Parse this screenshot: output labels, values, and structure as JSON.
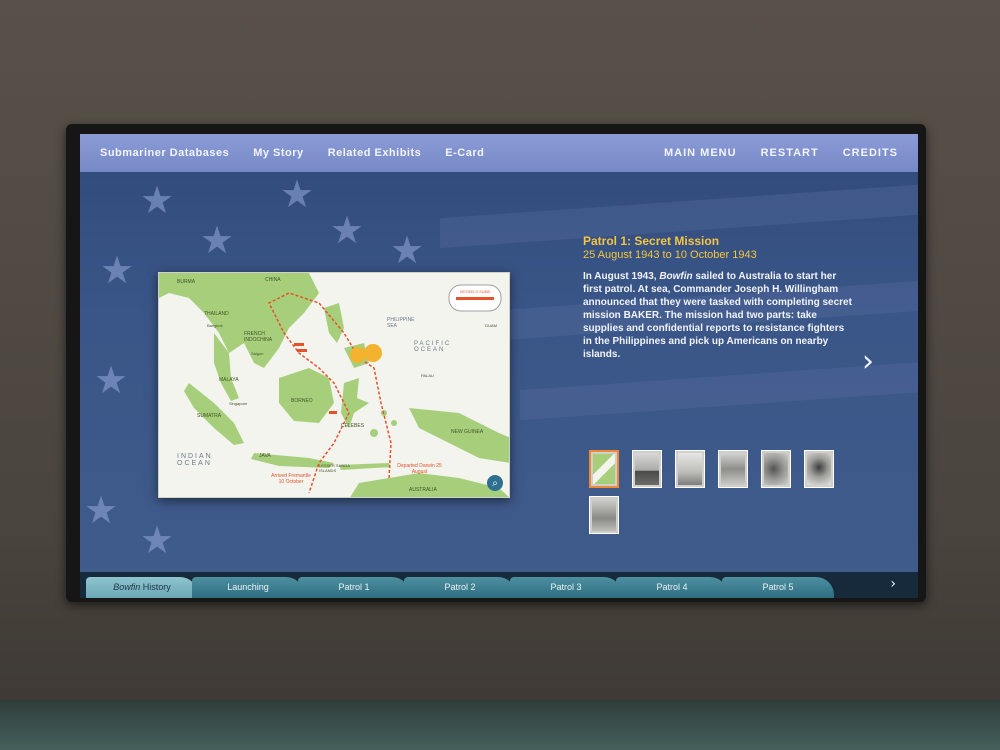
{
  "topnav": {
    "left": [
      "Submariner Databases",
      "My Story",
      "Related Exhibits",
      "E-Card"
    ],
    "right": [
      "MAIN MENU",
      "RESTART",
      "CREDITS"
    ]
  },
  "patrol": {
    "title": "Patrol 1: Secret Mission",
    "dates": "25 August 1943 to 10 October 1943",
    "body_before": "In August 1943, ",
    "body_em": "Bowfin",
    "body_after": " sailed to Australia to start her first patrol. At sea, Commander Joseph H. Willingham announced that they were tasked with completing secret mission BAKER. The mission had two parts: take supplies and confidential reports to resistance fighters in the Philippines and pick up Americans on nearby islands."
  },
  "map": {
    "labels": {
      "burma": "BURMA",
      "china": "CHINA",
      "thailand": "THAILAND",
      "french_indochina": "FRENCH INDOCHINA",
      "bangkok": "Bangkok",
      "saigon": "Saigon",
      "malaya": "MALAYA",
      "singapore": "Singapore",
      "sumatra": "SUMATRA",
      "borneo": "BORNEO",
      "celebes": "CELEBES",
      "java": "JAVA",
      "philippine_sea": "PHILIPPINE SEA",
      "pacific_ocean": "PACIFIC OCEAN",
      "indian_ocean": "INDIAN OCEAN",
      "new_guinea": "NEW GUINEA",
      "australia": "AUSTRALIA",
      "guam": "GUAM",
      "palau": "PALAU",
      "lesser_sunda": "LESSER SUNDA ISLANDS",
      "arrived": "Arrived Fremantle 10 October",
      "departed": "Departed Darwin 25 August",
      "legend_title": "VESSELS SUNK"
    }
  },
  "thumbnails": [
    "map-thumb",
    "submarine-thumb",
    "sea-thumb",
    "harbor-thumb",
    "crowd-thumb",
    "portrait-thumb",
    "crew-thumb"
  ],
  "bottom_tabs": {
    "first_em": "Bowfin",
    "first_rest": " History",
    "items": [
      "Launching",
      "Patrol 1",
      "Patrol 2",
      "Patrol 3",
      "Patrol 4",
      "Patrol 5"
    ]
  },
  "icons": {
    "next": "chevron-right-icon",
    "tabs_next": "chevron-right-icon",
    "zoom": "magnifier-icon"
  },
  "colors": {
    "nav_bar": "#7f90cc",
    "title_accent": "#f4c542",
    "tab_active": "#8ec4cf",
    "tab": "#3f8294"
  }
}
